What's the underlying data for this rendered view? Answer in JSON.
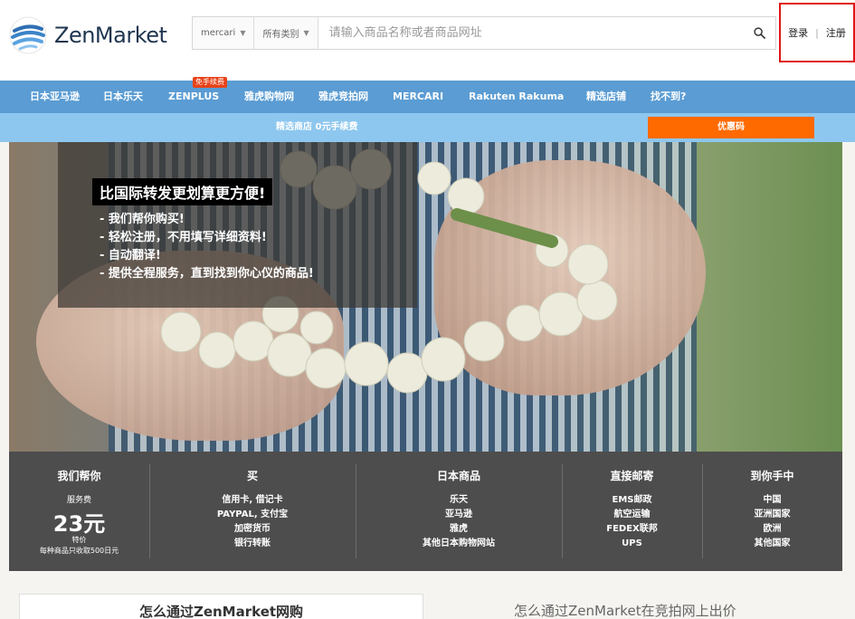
{
  "header": {
    "logo_text": "ZenMarket",
    "search": {
      "marketplace_select": "mercari",
      "category_select": "所有类别",
      "placeholder": "请输入商品名称或者商品网址"
    },
    "auth": {
      "login": "登录",
      "separator": "|",
      "register": "注册"
    }
  },
  "nav": {
    "items": [
      "日本亚马逊",
      "日本乐天",
      "ZENPLUS",
      "雅虎购物网",
      "雅虎竞拍网",
      "MERCARI",
      "Rakuten Rakuma",
      "精选店铺",
      "找不到?"
    ],
    "badge": "免手续费"
  },
  "promo": {
    "text": "精选商店 0元手续费",
    "coupon_button": "优惠码"
  },
  "hero": {
    "title": "比国际转发更划算更方便!",
    "lines": [
      "- 我们帮你购买!",
      "- 轻松注册，不用填写详细资料!",
      "- 自动翻译!",
      "- 提供全程服务，直到找到你心仪的商品!"
    ]
  },
  "info": {
    "col1": {
      "title": "我们帮你",
      "fee_label": "服务费",
      "fee_value": "23元",
      "fee_note": "特价",
      "fee_note2": "每种商品只收取500日元"
    },
    "col2": {
      "title": "买",
      "items": [
        "信用卡, 借记卡",
        "PAYPAL, 支付宝",
        "加密货币",
        "银行转账"
      ]
    },
    "col3": {
      "title": "日本商品",
      "items": [
        "乐天",
        "亚马逊",
        "雅虎",
        "其他日本购物网站"
      ]
    },
    "col4": {
      "title": "直接邮寄",
      "items": [
        "EMS邮政",
        "航空运输",
        "FEDEX联邦",
        "UPS"
      ]
    },
    "col5": {
      "title": "到你手中",
      "items": [
        "中国",
        "亚洲国家",
        "欧洲",
        "其他国家"
      ]
    }
  },
  "bottom": {
    "left_title": "怎么通过ZenMarket网购",
    "right_title": "怎么通过ZenMarket在竞拍网上出价"
  },
  "colors": {
    "nav_bg": "#5a9cd3",
    "promo_bg": "#8dc7ef",
    "coupon_bg": "#ff6a00",
    "badge_bg": "#e8431a",
    "info_bg": "#4d4d4d",
    "highlight_border": "#e01515"
  }
}
